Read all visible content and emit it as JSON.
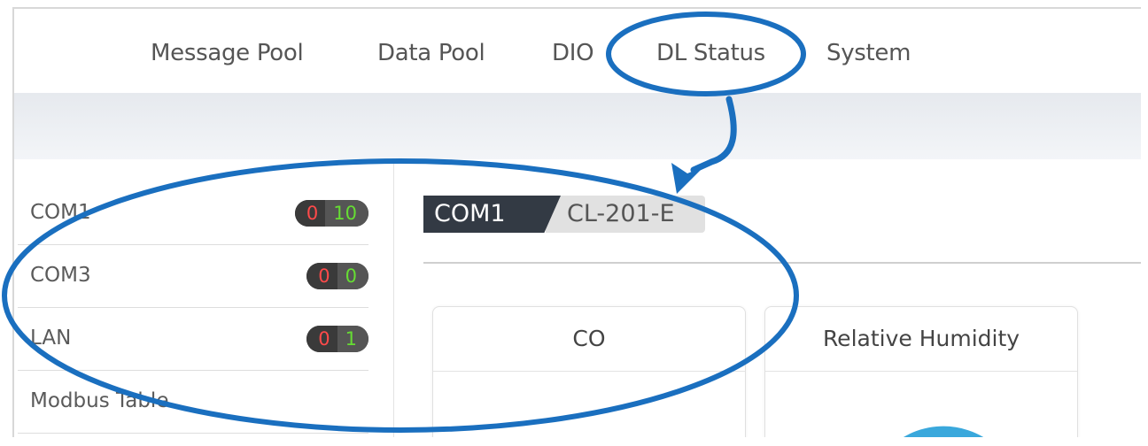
{
  "nav": {
    "items": [
      {
        "label": "Message Pool"
      },
      {
        "label": "Data Pool"
      },
      {
        "label": "DIO"
      },
      {
        "label": "DL Status"
      },
      {
        "label": "System"
      }
    ]
  },
  "sidebar": {
    "items": [
      {
        "label": "COM1",
        "err": "0",
        "ok": "10"
      },
      {
        "label": "COM3",
        "err": "0",
        "ok": "0"
      },
      {
        "label": "LAN",
        "err": "0",
        "ok": "1"
      },
      {
        "label": "Modbus Table"
      }
    ]
  },
  "main": {
    "port_tag": "COM1",
    "device_tag": "CL-201-E",
    "cards": [
      {
        "title": "CO"
      },
      {
        "title": "Relative Humidity"
      }
    ]
  },
  "colors": {
    "annotation": "#1a6fbf",
    "status_error": "#ff4a4a",
    "status_ok": "#66dd33",
    "gauge": "#3aa8dc"
  }
}
